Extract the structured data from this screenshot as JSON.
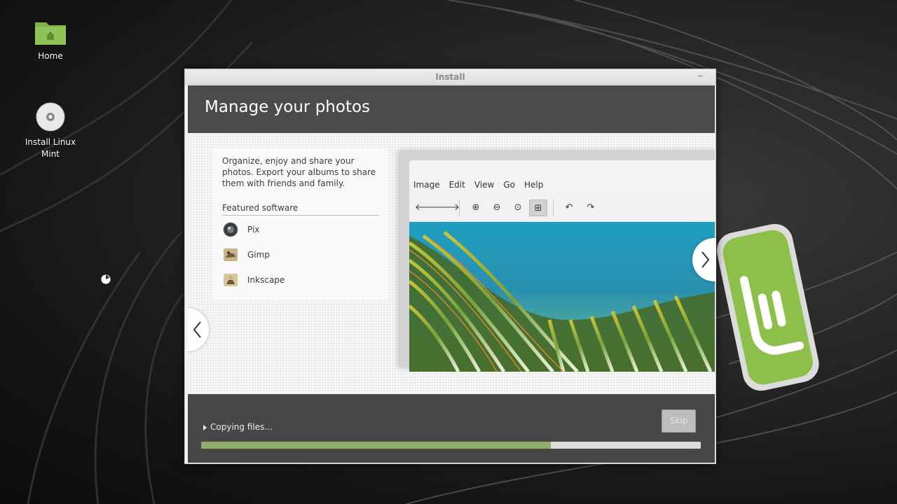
{
  "desktop": {
    "icons": [
      {
        "label": "Home",
        "icon": "folder-home-icon"
      },
      {
        "label": "Install Linux Mint",
        "icon": "cd-disc-icon"
      }
    ]
  },
  "window": {
    "title": "Install",
    "heading": "Manage your photos",
    "description": "Organize, enjoy and share your photos. Export your albums to share them with friends and family.",
    "featured_heading": "Featured software",
    "apps": [
      {
        "label": "Pix",
        "icon": "pix-app-icon"
      },
      {
        "label": "Gimp",
        "icon": "gimp-app-icon"
      },
      {
        "label": "Inkscape",
        "icon": "inkscape-app-icon"
      }
    ],
    "preview": {
      "menu": [
        "Image",
        "Edit",
        "View",
        "Go",
        "Help"
      ],
      "toolbar_icons": [
        "back-arrow-icon",
        "forward-arrow-icon",
        "zoom-in-icon",
        "zoom-out-icon",
        "zoom-original-icon",
        "fit-window-icon",
        "rotate-left-icon",
        "rotate-right-icon"
      ]
    },
    "status": "Copying files...",
    "skip_label": "Skip",
    "progress": 0.7
  },
  "colors": {
    "mint_green": "#8fae6b",
    "header_bg": "#4b4b4b"
  }
}
